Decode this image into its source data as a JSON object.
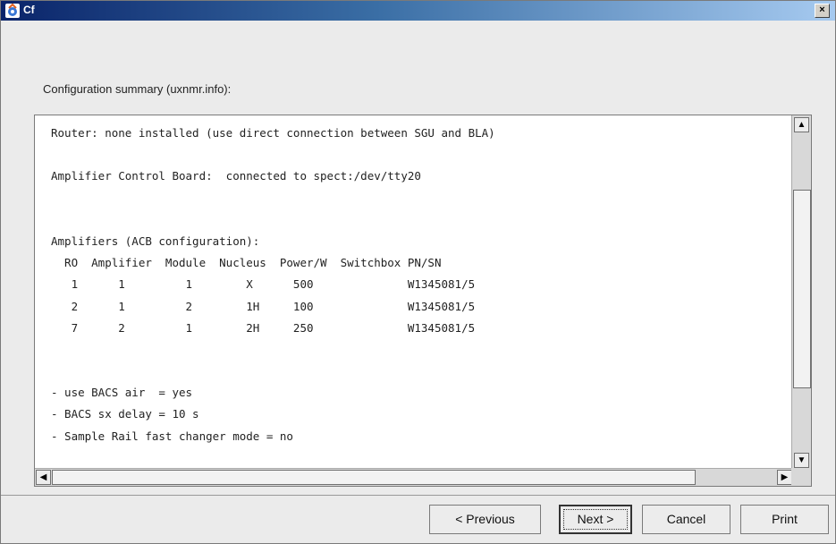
{
  "window": {
    "title": "Cf",
    "close_label": "×"
  },
  "summary_label": "Configuration summary (uxnmr.info):",
  "text_lines": [
    "Router: none installed (use direct connection between SGU and BLA)",
    "",
    "Amplifier Control Board:  connected to spect:/dev/tty20",
    "",
    "",
    "Amplifiers (ACB configuration):",
    "  RO  Amplifier  Module  Nucleus  Power/W  Switchbox PN/SN",
    "   1      1         1        X      500              W1345081/5",
    "   2      1         2        1H     100              W1345081/5",
    "   7      2         1        2H     250              W1345081/5",
    "",
    "",
    "- use BACS air  = yes",
    "- BACS sx delay = 10 s",
    "- Sample Rail fast changer mode = no"
  ],
  "scrollbars": {
    "up": "▲",
    "down": "▼",
    "left": "◀",
    "right": "▶"
  },
  "buttons": {
    "previous": "< Previous",
    "next": "Next >",
    "cancel": "Cancel",
    "print": "Print"
  },
  "colors": {
    "titlebar_start": "#0a246a",
    "titlebar_end": "#a6caf0",
    "dialog_bg": "#ebebeb"
  }
}
